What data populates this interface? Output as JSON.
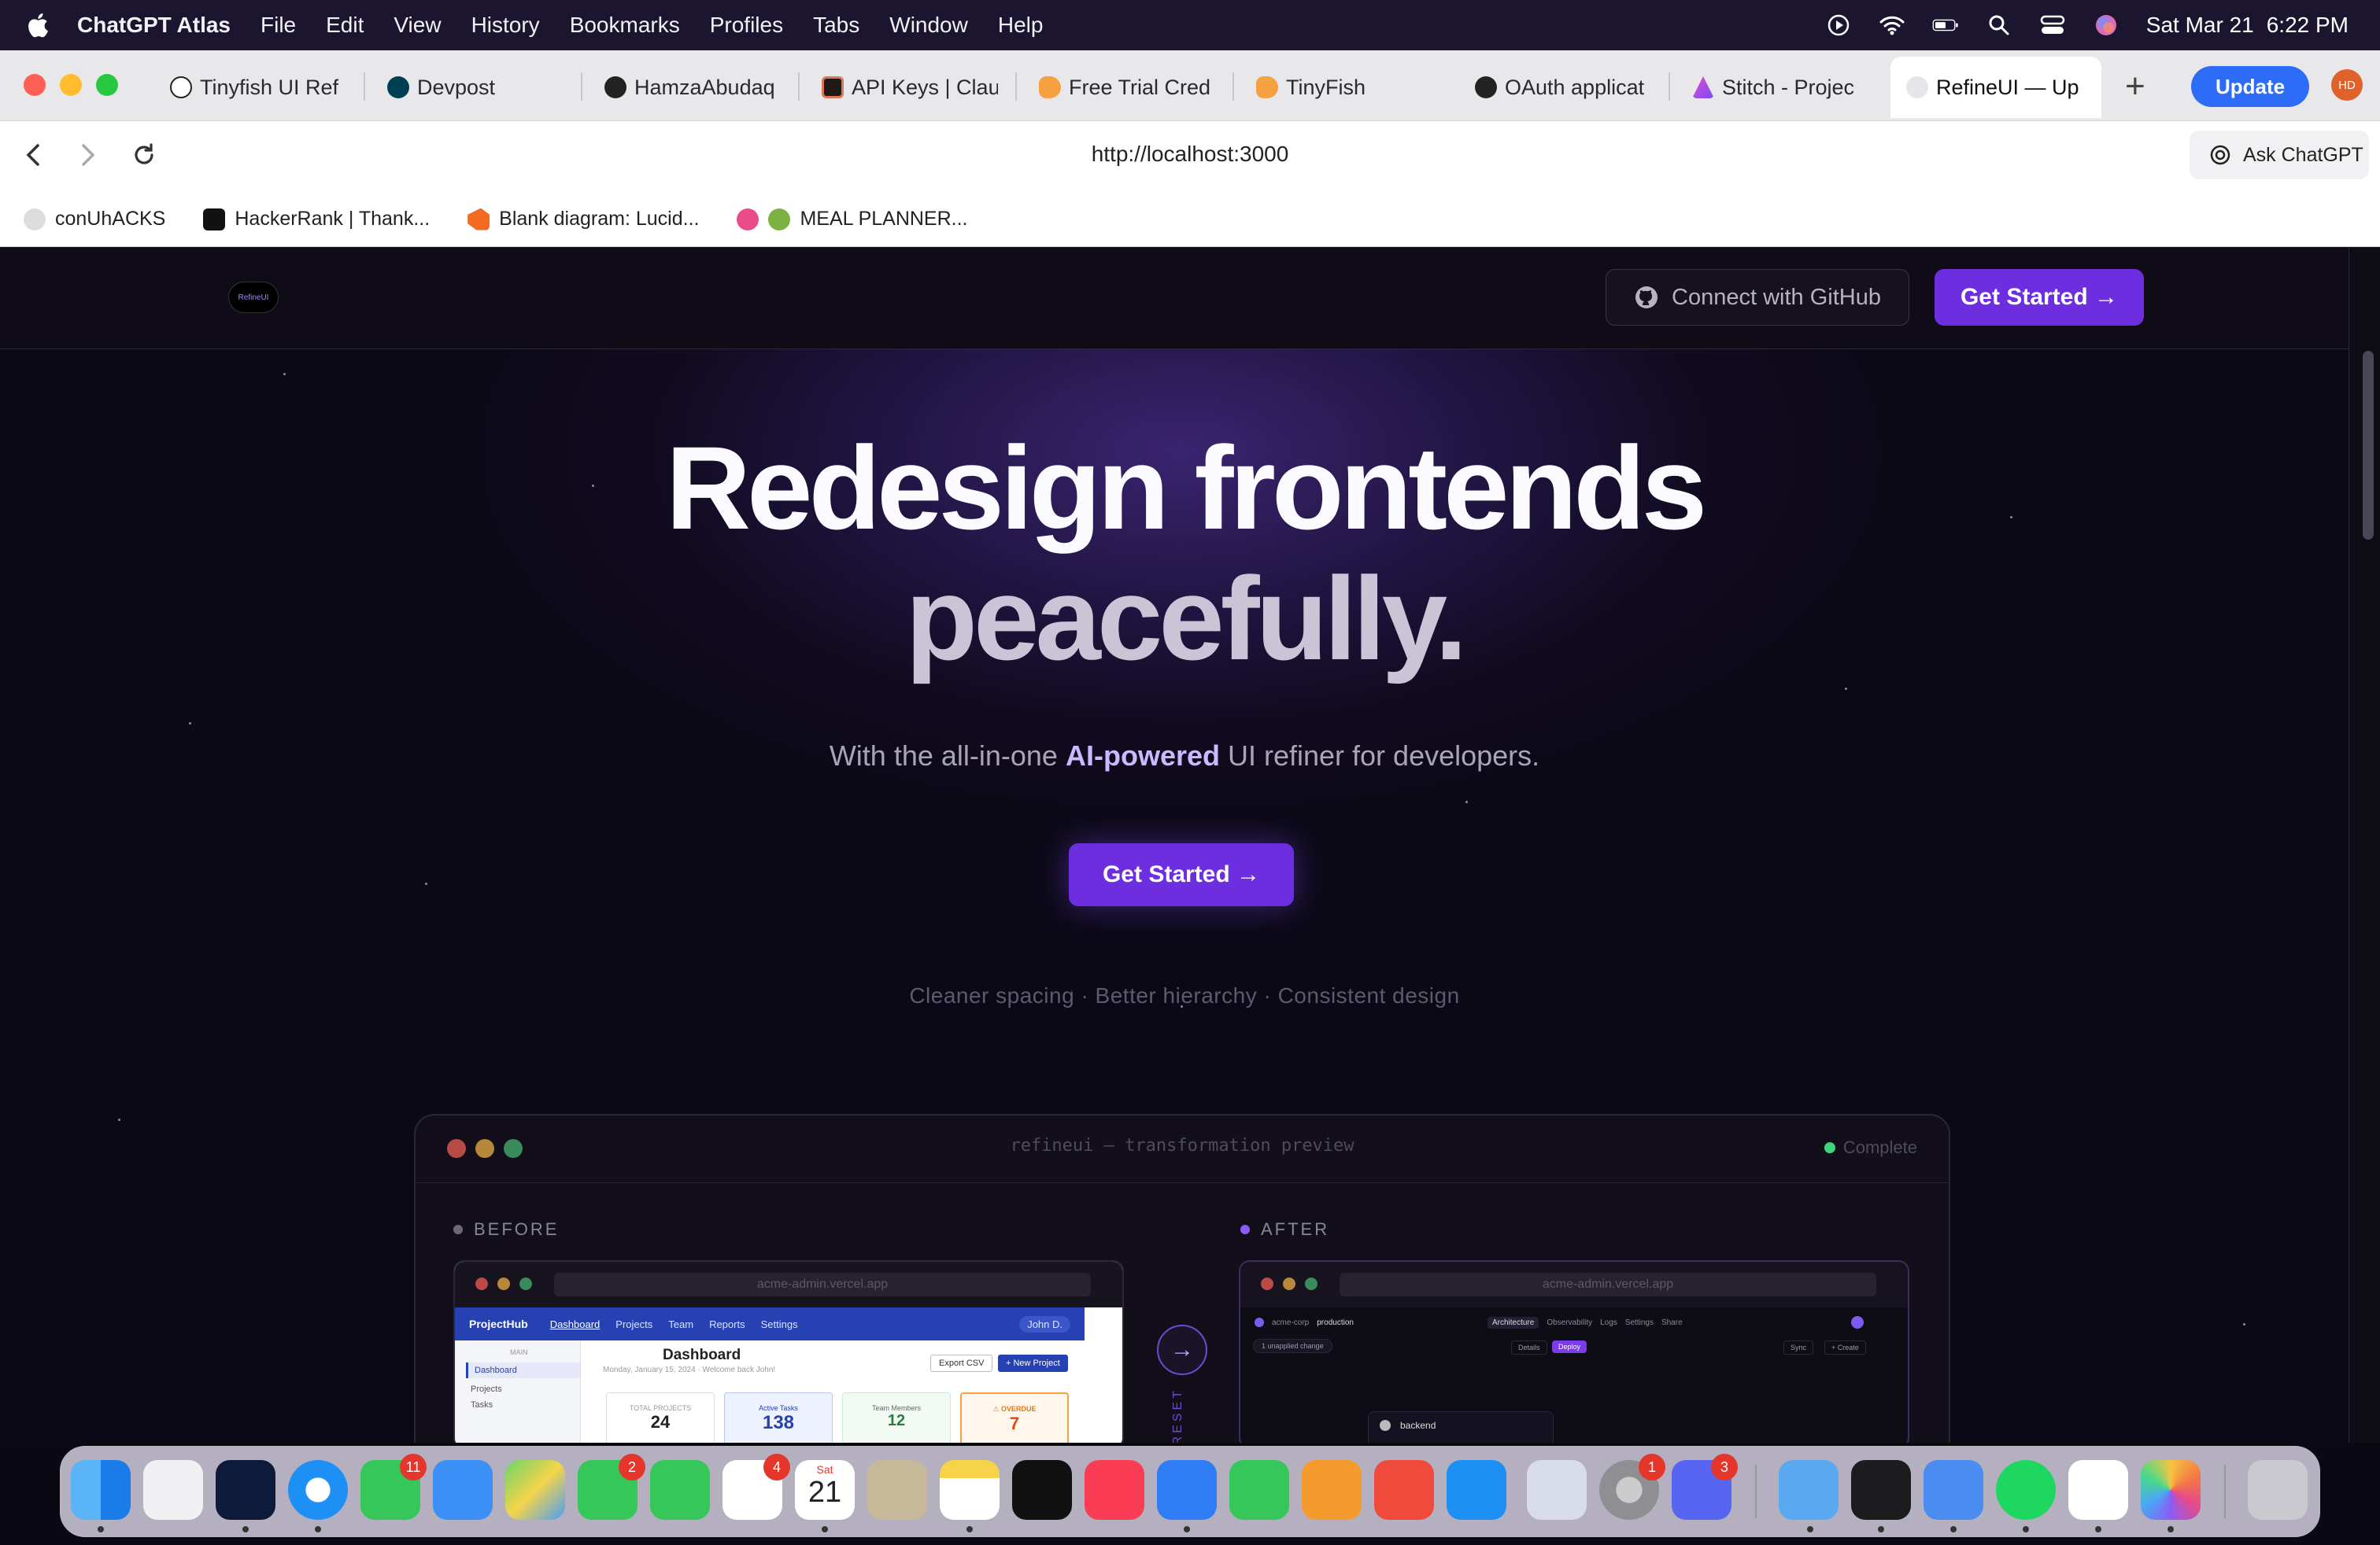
{
  "menubar": {
    "app_name": "ChatGPT Atlas",
    "menus": [
      "File",
      "Edit",
      "View",
      "History",
      "Bookmarks",
      "Profiles",
      "Tabs",
      "Window",
      "Help"
    ],
    "date": "Sat Mar 21",
    "time": "6:22 PM",
    "status_icons": [
      "play-icon",
      "wifi-icon",
      "battery-icon",
      "spotlight-icon",
      "control-center-icon",
      "siri-icon"
    ]
  },
  "tabs": [
    {
      "label": "Tinyfish UI Ref",
      "icon": "openai-icon"
    },
    {
      "label": "Devpost",
      "icon": "devpost-icon"
    },
    {
      "label": "HamzaAbudaq",
      "icon": "github-icon"
    },
    {
      "label": "API Keys | Clau",
      "icon": "claude-icon"
    },
    {
      "label": "Free Trial Cred",
      "icon": "tinyfish-icon"
    },
    {
      "label": "TinyFish",
      "icon": "tinyfish-icon"
    },
    {
      "label": "OAuth applicat",
      "icon": "github-icon"
    },
    {
      "label": "Stitch - Projec",
      "icon": "stitch-icon"
    },
    {
      "label": "RefineUI — Up",
      "icon": "refineui-icon",
      "active": true
    }
  ],
  "toolbar": {
    "new_tab": "+",
    "update_label": "Update",
    "avatar_initials": "HD",
    "url": "http://localhost:3000",
    "ask_label": "Ask ChatGPT"
  },
  "bookmarks": [
    {
      "label": "conUhACKS"
    },
    {
      "label": "HackerRank | Thank..."
    },
    {
      "label": "Blank diagram: Lucid..."
    },
    {
      "label": "MEAL PLANNER..."
    }
  ],
  "site": {
    "logo_text": "RefineUI",
    "github_label": "Connect with GitHub",
    "nav_cta": "Get Started →",
    "hero_line1": "Redesign frontends",
    "hero_line2": "peacefully.",
    "sub_prefix": "With the all-in-one ",
    "sub_highlight": "AI-powered",
    "sub_suffix": " UI refiner for developers.",
    "cta": "Get Started →",
    "taglines": "Cleaner spacing · Better hierarchy · Consistent design"
  },
  "preview": {
    "title": "refineui — transformation preview",
    "status": "Complete",
    "before_label": "BEFORE",
    "after_label": "AFTER",
    "preset_label": "PRESET",
    "before": {
      "url": "acme-admin.vercel.app",
      "brand": "ProjectHub",
      "nav": [
        "Dashboard",
        "Projects",
        "Team",
        "Reports",
        "Settings"
      ],
      "user": "John D.",
      "sidebar_section": "MAIN",
      "sidebar": [
        "Dashboard",
        "Projects",
        "Tasks"
      ],
      "heading": "Dashboard",
      "subheading": "Monday, January 15, 2024 · Welcome back John!",
      "export_label": "Export CSV",
      "new_label": "+ New Project",
      "stats": [
        {
          "label": "TOTAL PROJECTS",
          "value": "24"
        },
        {
          "label": "Active Tasks",
          "value": "138"
        },
        {
          "label": "Team Members",
          "value": "12"
        },
        {
          "label": "⚠ OVERDUE",
          "value": "7"
        }
      ]
    },
    "after": {
      "url": "acme-admin.vercel.app",
      "org": "acme-corp",
      "env": "production",
      "tabs": [
        "Architecture",
        "Observability",
        "Logs",
        "Settings",
        "Share"
      ],
      "unapplied": "1 unapplied change",
      "subtabs": [
        "Details",
        "Deploy"
      ],
      "sync": "Sync",
      "create": "+ Create",
      "card_label": "backend"
    }
  },
  "dock": {
    "apps": [
      "Finder",
      "Launchpad",
      "Copilot",
      "Safari",
      "Messages",
      "Mail",
      "Maps",
      "FaceTime",
      "Phone",
      "Reminders",
      "Calendar",
      "Contacts",
      "Notes",
      "TV",
      "Music",
      "Keynote",
      "Numbers",
      "Pages",
      "Rocket",
      "App Store",
      "iPhone Mirroring",
      "System Settings",
      "Discord",
      "Folder",
      "Terminal",
      "Xcode",
      "Spotify",
      "VS Code",
      "Photos",
      "Trash"
    ],
    "badges": {
      "messages": "11",
      "facetime": "2",
      "reminders": "4",
      "settings": "1",
      "discord": "3"
    },
    "calendar_day": "Sat",
    "calendar_date": "21"
  },
  "colors": {
    "accent": "#6d2ee0",
    "update_blue": "#2d6cf6",
    "complete_green": "#3fd37a"
  }
}
